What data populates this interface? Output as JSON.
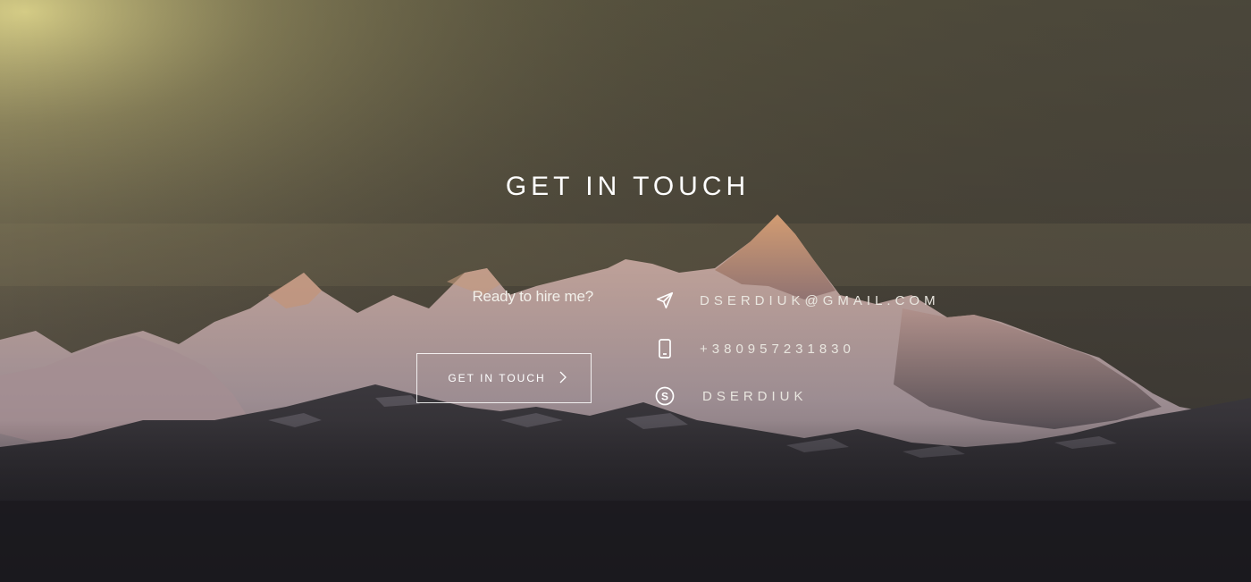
{
  "section": {
    "title": "GET IN TOUCH"
  },
  "cta": {
    "question": "Ready to hire me?",
    "button_label": "GET IN TOUCH"
  },
  "contacts": {
    "email": "DSERDIUK@GMAIL.COM",
    "phone": "+380957231830",
    "skype": "DSERDIUK"
  },
  "icons": {
    "email": "send-paper-plane-icon",
    "phone": "mobile-phone-icon",
    "skype": "skype-icon",
    "button": "chevron-right-icon"
  },
  "colors": {
    "sky_top_left": "#d6cf83",
    "sky_mid": "#6e664c",
    "sky_right": "#3f3c37",
    "foreground_dark": "#1c1b1f",
    "text": "#ffffff"
  }
}
